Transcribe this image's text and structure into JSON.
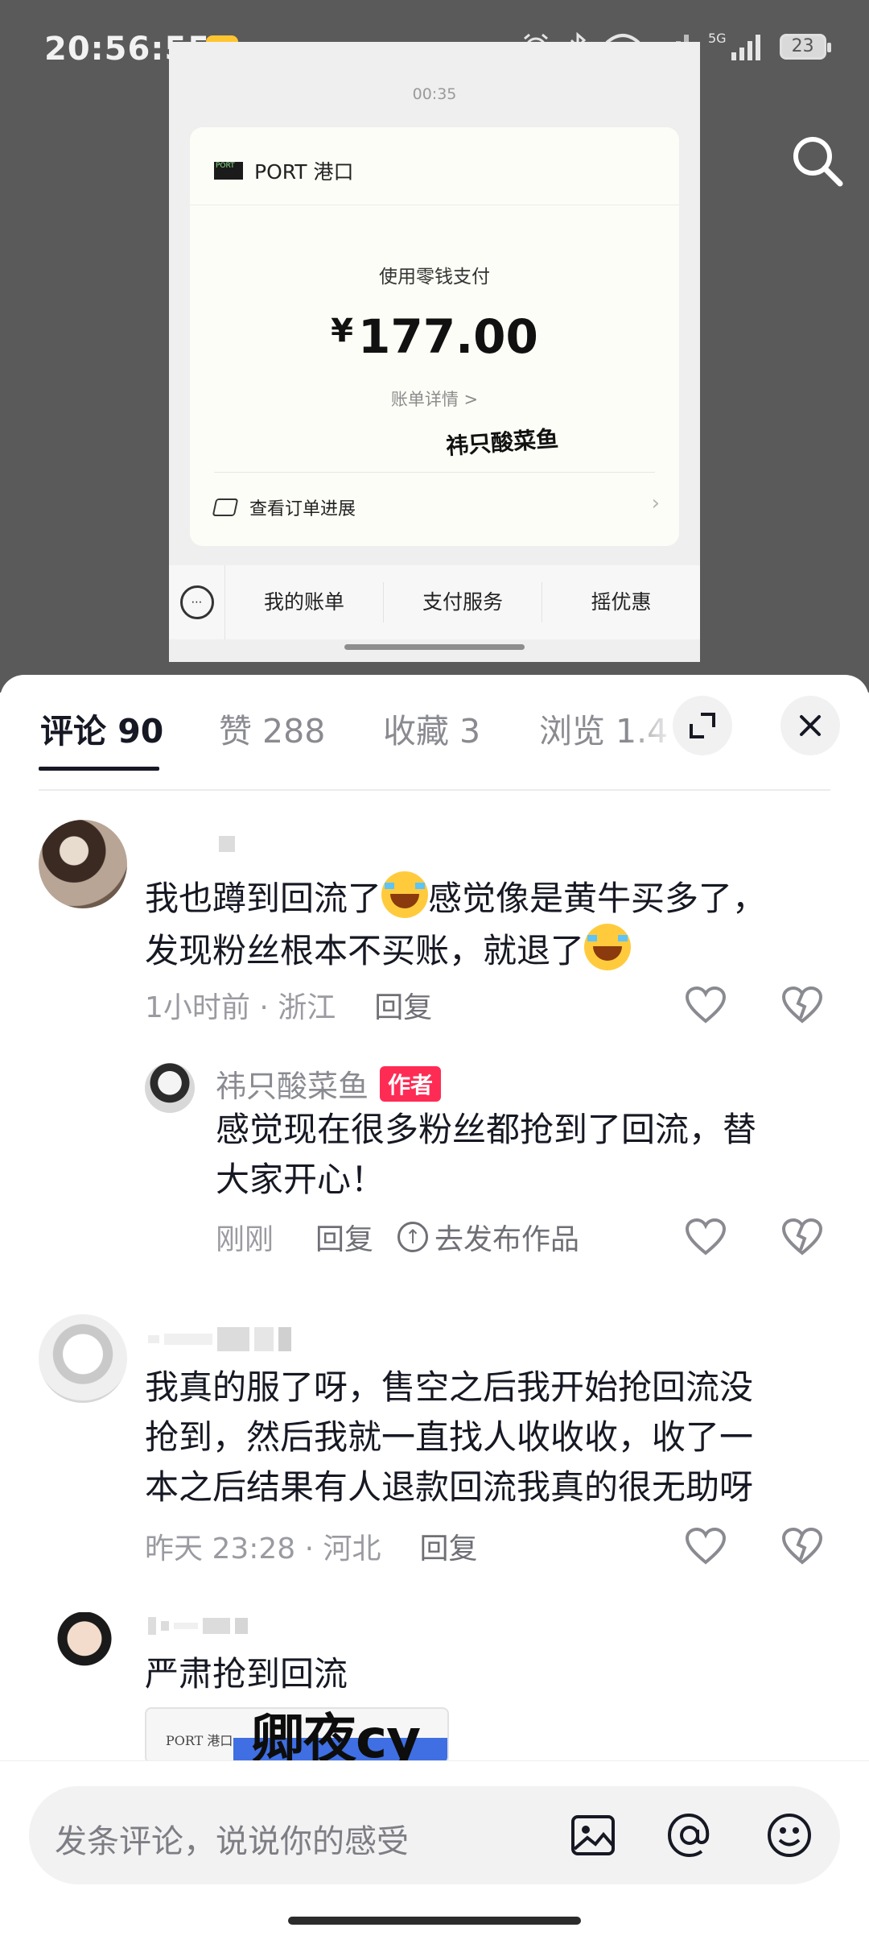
{
  "status_bar": {
    "time": "20:56:55",
    "battery": "23",
    "network": "5G"
  },
  "screenshot": {
    "timer": "00:35",
    "merchant": "PORT 港口",
    "merchant_logo_text": "PORT",
    "pay_method": "使用零钱支付",
    "currency": "¥",
    "amount": "177.00",
    "bill_detail": "账单详情 >",
    "watermark": "祎只酸菜鱼",
    "order_progress": "查看订单进展",
    "tabs": [
      "我的账单",
      "支付服务",
      "摇优惠"
    ]
  },
  "tabs": {
    "comments": "评论 90",
    "likes": "赞 288",
    "favorites": "收藏 3",
    "views": "浏览 1.4"
  },
  "comments": [
    {
      "text_part1": "我也蹲到回流了",
      "text_part2": "感觉像是黄牛买多了，",
      "text_line2": "发现粉丝根本不买账，就退了",
      "time_location": "1小时前 · 浙江",
      "reply": "回复",
      "replies": [
        {
          "author": "祎只酸菜鱼",
          "badge": "作者",
          "text_line1": "感觉现在很多粉丝都抢到了回流，替",
          "text_line2": "大家开心！",
          "time": "刚刚",
          "reply": "回复",
          "publish": "去发布作品"
        }
      ]
    },
    {
      "text_line1": "我真的服了呀，售空之后我开始抢回流没",
      "text_line2": "抢到，然后我就一直找人收收收，收了一",
      "text_line3": "本之后结果有人退款回流我真的很无助呀",
      "time_location": "昨天 23:28 · 河北",
      "reply": "回复"
    },
    {
      "text_line1": "严肃抢到回流",
      "image_overlay": "卿夜cy",
      "image_label": "PORT 港口"
    }
  ],
  "input": {
    "placeholder": "发条评论，说说你的感受"
  },
  "colors": {
    "accent": "#fe2c55",
    "text": "#161823",
    "muted": "#8a8b91"
  }
}
